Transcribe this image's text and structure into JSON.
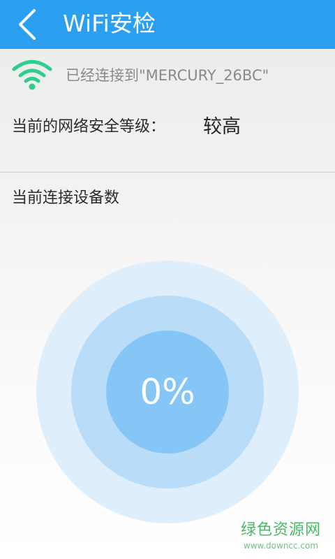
{
  "app_bar": {
    "title": "WiFi安检",
    "back_icon": "chevron-left-icon",
    "color": "#2b9ff0"
  },
  "connection": {
    "icon": "wifi-icon",
    "icon_color": "#2dcf8e",
    "text": "已经连接到\"MERCURY_26BC\""
  },
  "security": {
    "label": "当前的网络安全等级：",
    "value": "较高"
  },
  "devices": {
    "label": "当前连接设备数",
    "percent_text": "0%",
    "ring_colors": [
      "#dfeefb",
      "#b9dcf9",
      "#86c6f7"
    ]
  },
  "watermark": {
    "title": "绿色资源网",
    "url": "www.downcc.com"
  }
}
